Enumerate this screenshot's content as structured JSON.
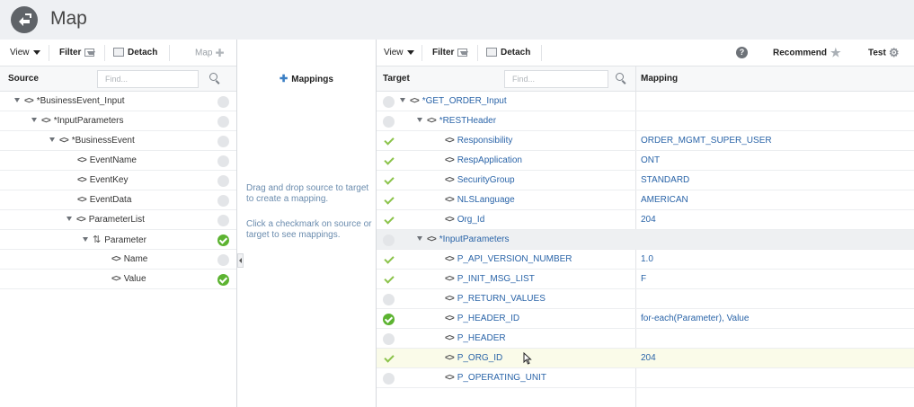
{
  "title": "Map",
  "colors": {
    "accent": "#2a64a8",
    "check_green": "#5cb331",
    "title_bg": "#eef0f3"
  },
  "left_toolbar": {
    "view": "View",
    "filter": "Filter",
    "detach": "Detach",
    "map": "Map"
  },
  "source": {
    "header": "Source",
    "find_placeholder": "Find...",
    "rows": [
      {
        "label": "*BusinessEvent_Input",
        "status": "empty"
      },
      {
        "label": "*InputParameters",
        "status": "empty"
      },
      {
        "label": "*BusinessEvent",
        "status": "empty"
      },
      {
        "label": "EventName",
        "status": "empty"
      },
      {
        "label": "EventKey",
        "status": "empty"
      },
      {
        "label": "EventData",
        "status": "empty"
      },
      {
        "label": "ParameterList",
        "status": "empty"
      },
      {
        "label": "Parameter",
        "status": "filled"
      },
      {
        "label": "Name",
        "status": "empty"
      },
      {
        "label": "Value",
        "status": "filled"
      }
    ]
  },
  "mid": {
    "header": "Mappings",
    "hint1": "Drag and drop source to target to create a mapping.",
    "hint2": "Click a checkmark on source or target to see mappings."
  },
  "right_toolbar": {
    "view": "View",
    "filter": "Filter",
    "detach": "Detach",
    "recommend": "Recommend",
    "test": "Test"
  },
  "target": {
    "header": "Target",
    "find_placeholder": "Find...",
    "mapping_header": "Mapping",
    "rows": [
      {
        "label": "*GET_ORDER_Input",
        "status": "empty",
        "mapping": ""
      },
      {
        "label": "*RESTHeader",
        "status": "empty",
        "mapping": ""
      },
      {
        "label": "Responsibility",
        "status": "check",
        "mapping": "ORDER_MGMT_SUPER_USER"
      },
      {
        "label": "RespApplication",
        "status": "check",
        "mapping": "ONT"
      },
      {
        "label": "SecurityGroup",
        "status": "check",
        "mapping": "STANDARD"
      },
      {
        "label": "NLSLanguage",
        "status": "check",
        "mapping": "AMERICAN"
      },
      {
        "label": "Org_Id",
        "status": "check",
        "mapping": "204"
      },
      {
        "label": "*InputParameters",
        "status": "empty",
        "mapping": ""
      },
      {
        "label": "P_API_VERSION_NUMBER",
        "status": "check",
        "mapping": "1.0"
      },
      {
        "label": "P_INIT_MSG_LIST",
        "status": "check",
        "mapping": "F"
      },
      {
        "label": "P_RETURN_VALUES",
        "status": "empty",
        "mapping": ""
      },
      {
        "label": "P_HEADER_ID",
        "status": "filled",
        "mapping": "for-each(Parameter), Value"
      },
      {
        "label": "P_HEADER",
        "status": "empty",
        "mapping": ""
      },
      {
        "label": "P_ORG_ID",
        "status": "check",
        "mapping": "204"
      },
      {
        "label": "P_OPERATING_UNIT",
        "status": "empty",
        "mapping": ""
      }
    ]
  }
}
